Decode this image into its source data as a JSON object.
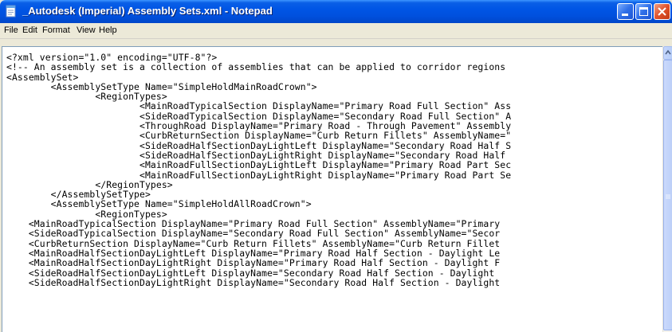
{
  "window": {
    "title": "_Autodesk (Imperial) Assembly Sets.xml - Notepad",
    "app_icon": "notepad-icon",
    "controls": [
      "minimize-icon",
      "maximize-icon",
      "close-icon"
    ]
  },
  "menu": {
    "items": [
      "File",
      "Edit",
      "Format",
      "View",
      "Help"
    ]
  },
  "editor": {
    "lines": [
      "<?xml version=\"1.0\" encoding=\"UTF-8\"?>",
      "<!-- An assembly set is a collection of assemblies that can be applied to corridor regions",
      "<AssemblySet>",
      "\t<AssemblySetType Name=\"SimpleHoldMainRoadCrown\">",
      "\t\t<RegionTypes>",
      "\t\t\t<MainRoadTypicalSection DisplayName=\"Primary Road Full Section\" Ass",
      "\t\t\t<SideRoadTypicalSection DisplayName=\"Secondary Road Full Section\" A",
      "\t\t\t<ThroughRoad DisplayName=\"Primary Road - Through Pavement\" Assembly",
      "\t\t\t<CurbReturnSection DisplayName=\"Curb Return Fillets\" AssemblyName=\"",
      "\t\t\t<SideRoadHalfSectionDayLightLeft DisplayName=\"Secondary Road Half S",
      "\t\t\t<SideRoadHalfSectionDayLightRight DisplayName=\"Secondary Road Half",
      "\t\t\t<MainRoadFullSectionDayLightLeft DisplayName=\"Primary Road Part Sec",
      "\t\t\t<MainRoadFullSectionDayLightRight DisplayName=\"Primary Road Part Se",
      "\t\t</RegionTypes>",
      "\t</AssemblySetType>",
      "\t<AssemblySetType Name=\"SimpleHoldAllRoadCrown\">",
      "\t\t<RegionTypes>",
      "    <MainRoadTypicalSection DisplayName=\"Primary Road Full Section\" AssemblyName=\"Primary",
      "    <SideRoadTypicalSection DisplayName=\"Secondary Road Full Section\" AssemblyName=\"Secor",
      "    <CurbReturnSection DisplayName=\"Curb Return Fillets\" AssemblyName=\"Curb Return Fillet",
      "    <MainRoadHalfSectionDayLightLeft DisplayName=\"Primary Road Half Section - Daylight Le",
      "    <MainRoadHalfSectionDayLightRight DisplayName=\"Primary Road Half Section - Daylight F",
      "    <SideRoadHalfSectionDayLightLeft DisplayName=\"Secondary Road Half Section - Daylight",
      "    <SideRoadHalfSectionDayLightRight DisplayName=\"Secondary Road Half Section - Daylight"
    ]
  },
  "scrollbar": {
    "up_icon": "scroll-up-arrow-icon",
    "thumb_grip_icon": "grip-icon"
  },
  "colors": {
    "title_bar": "#0055e5",
    "title_text": "#ffffff",
    "menu_background": "#ece9d8",
    "editor_background": "#ffffff",
    "close_button": "#e0522b"
  }
}
